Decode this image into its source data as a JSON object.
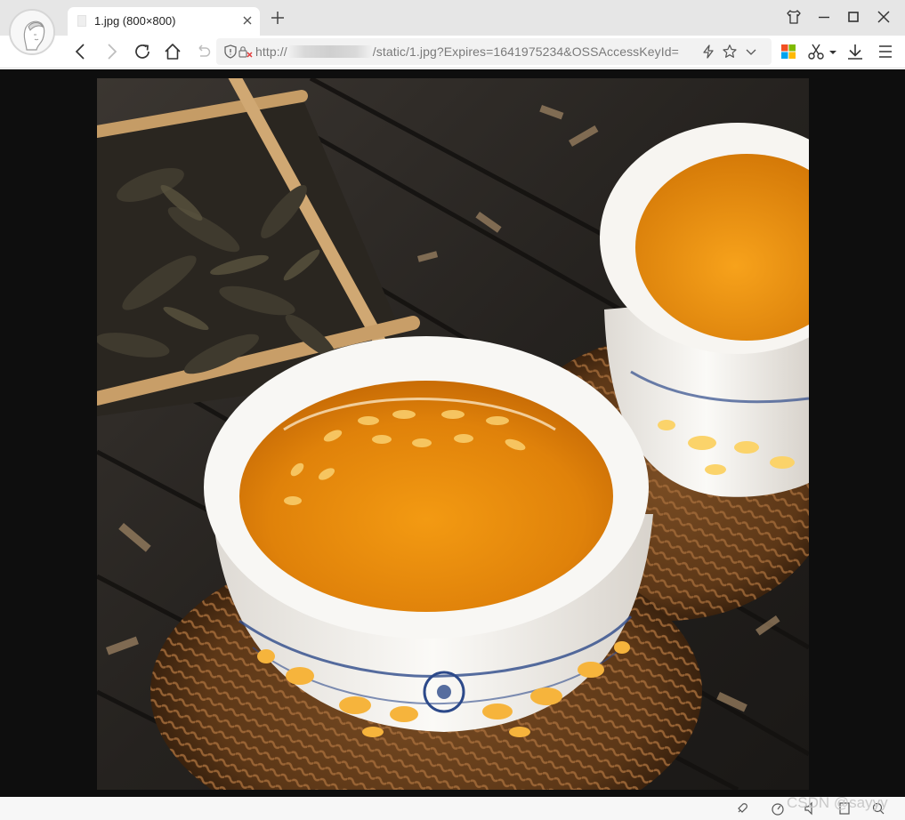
{
  "tab": {
    "title": "1.jpg (800×800)",
    "favicon": "image-file-icon"
  },
  "address_bar": {
    "url_prefix": "http://",
    "url_suffix": "/static/1.jpg?Expires=1641975234&OSSAccessKeyId="
  },
  "watermark": "CSDN @sayyy",
  "icons": {
    "back": "back-arrow-icon",
    "forward": "forward-arrow-icon",
    "reload": "reload-icon",
    "home": "home-icon",
    "undo": "undo-close-tab-icon",
    "security": "shield-icon",
    "lightning": "lightning-icon",
    "star": "star-icon",
    "dropdown": "chevron-down-icon",
    "apps": "apps-grid-icon",
    "scissors": "scissors-icon",
    "download": "download-icon",
    "menu": "menu-icon"
  },
  "colors": {
    "window_chrome": "#e6e6e6",
    "image_background": "#0e0e0e",
    "tea": "#e58a0a"
  }
}
